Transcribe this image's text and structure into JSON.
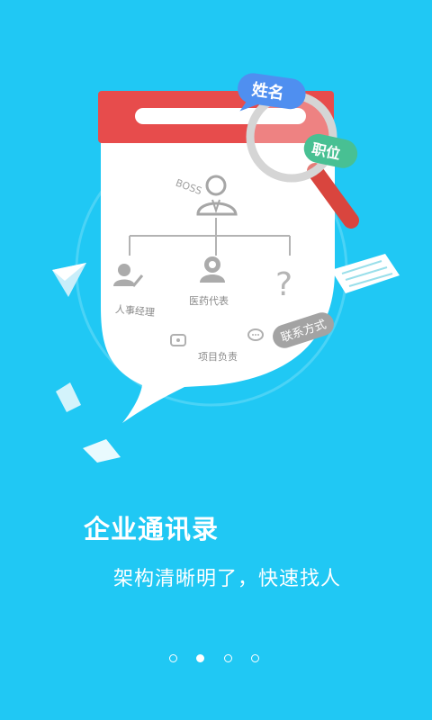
{
  "colors": {
    "background": "#20c8f4",
    "card_header": "#e74c4c",
    "tag_blue": "#4f8ff0",
    "tag_green": "#48c093",
    "tag_gray": "#9e9e9e"
  },
  "illustration": {
    "tag_name": "姓名",
    "tag_position": "职位",
    "tag_contact": "联系方式",
    "org_root_label": "BOSS",
    "org_nodes": [
      {
        "label": "人事经理",
        "icon": "user-edit-icon"
      },
      {
        "label": "医药代表",
        "icon": "user-badge-icon"
      },
      {
        "label": "",
        "icon": "question-mark-icon"
      }
    ],
    "contact_label": "项目负责",
    "icons": [
      "user-icon",
      "magnifier-icon",
      "paper-plane-icon",
      "phone-icon",
      "chat-icon",
      "document-icon"
    ]
  },
  "intro": {
    "title": "企业通讯录",
    "subtitle": "架构清晰明了，快速找人"
  },
  "pager": {
    "total": 4,
    "active_index": 1
  }
}
